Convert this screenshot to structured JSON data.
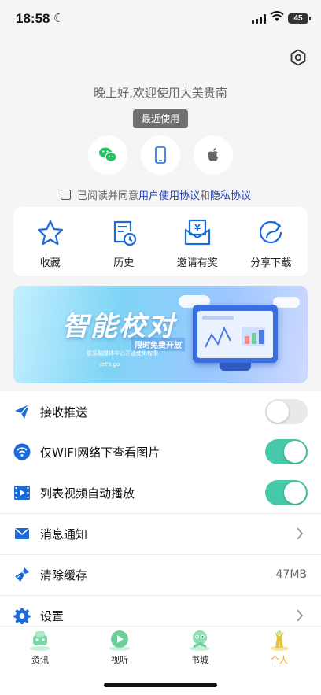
{
  "status_bar": {
    "time": "18:58",
    "battery": "45"
  },
  "greeting": "晚上好,欢迎使用大美贵南",
  "recent_label": "最近使用",
  "login_options": [
    {
      "icon": "wechat-icon"
    },
    {
      "icon": "phone-icon"
    },
    {
      "icon": "apple-icon"
    }
  ],
  "agreement": {
    "prefix": "已阅读并同意",
    "user_agreement": "用户使用协议",
    "and": "和",
    "privacy": "隐私协议",
    "checked": false
  },
  "quick_actions": [
    {
      "label": "收藏",
      "icon": "star-icon"
    },
    {
      "label": "历史",
      "icon": "history-icon"
    },
    {
      "label": "邀请有奖",
      "icon": "invite-reward-icon"
    },
    {
      "label": "分享下载",
      "icon": "share-icon"
    }
  ],
  "banner": {
    "title": "智能校对",
    "subtitle": "限时免费开放",
    "caption": "联系融媒体中心开通使用权限",
    "go": "let's go"
  },
  "settings": [
    {
      "label": "接收推送",
      "icon": "paper-plane-icon",
      "type": "toggle",
      "on": false
    },
    {
      "label": "仅WIFI网络下查看图片",
      "icon": "wifi-icon",
      "type": "toggle",
      "on": true
    },
    {
      "label": "列表视频自动播放",
      "icon": "video-icon",
      "type": "toggle",
      "on": true
    },
    {
      "label": "消息通知",
      "icon": "envelope-icon",
      "type": "link"
    },
    {
      "label": "清除缓存",
      "icon": "broom-icon",
      "type": "value",
      "value": "47MB"
    },
    {
      "label": "设置",
      "icon": "gear-icon",
      "type": "link"
    }
  ],
  "tabs": [
    {
      "label": "资讯",
      "icon": "news-icon",
      "active": false
    },
    {
      "label": "视听",
      "icon": "play-icon",
      "active": false
    },
    {
      "label": "书城",
      "icon": "bookstore-icon",
      "active": false
    },
    {
      "label": "个人",
      "icon": "person-icon",
      "active": true
    }
  ],
  "colors": {
    "accent_blue": "#2440b8",
    "toggle_on": "#45c9a8",
    "tab_active": "#e0b010",
    "icon_blue": "#1a6ad8"
  }
}
